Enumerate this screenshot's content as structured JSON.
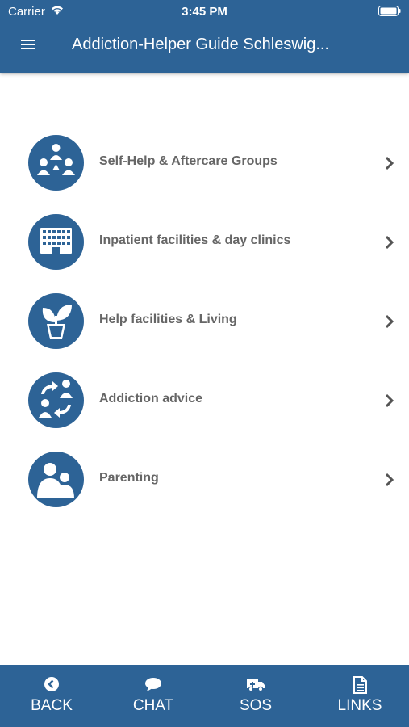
{
  "status_bar": {
    "carrier": "Carrier",
    "time": "3:45 PM"
  },
  "header": {
    "title": "Addiction-Helper Guide Schleswig...",
    "menu_icon": "hamburger-menu-icon"
  },
  "menu_items": [
    {
      "label": "Self-Help & Aftercare Groups",
      "icon": "group-meeting-icon"
    },
    {
      "label": "Inpatient facilities & day clinics",
      "icon": "building-icon"
    },
    {
      "label": "Help facilities & Living",
      "icon": "potted-plant-icon"
    },
    {
      "label": "Addiction advice",
      "icon": "consultation-exchange-icon"
    },
    {
      "label": "Parenting",
      "icon": "parent-child-icon"
    }
  ],
  "bottom_nav": [
    {
      "label": "BACK",
      "icon": "back-circle-icon"
    },
    {
      "label": "CHAT",
      "icon": "chat-bubble-icon"
    },
    {
      "label": "SOS",
      "icon": "ambulance-icon"
    },
    {
      "label": "LINKS",
      "icon": "document-icon"
    }
  ],
  "colors": {
    "primary": "#2d6396",
    "label_text": "#666666",
    "background": "#ffffff"
  }
}
